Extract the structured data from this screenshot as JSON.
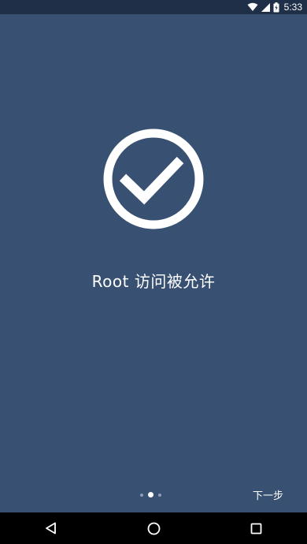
{
  "status_bar": {
    "time": "5:33",
    "icons": [
      "wifi-icon",
      "signal-icon",
      "battery-charging-icon"
    ]
  },
  "main": {
    "icon": "check-circle-icon",
    "title": "Root 访问被允许",
    "pager": {
      "total": 3,
      "current": 2
    },
    "next_label": "下一步"
  },
  "nav_bar": {
    "buttons": [
      "back-icon",
      "home-icon",
      "recents-icon"
    ]
  },
  "colors": {
    "background": "#385072",
    "status_bar": "#1f2f47",
    "foreground": "#ffffff"
  }
}
